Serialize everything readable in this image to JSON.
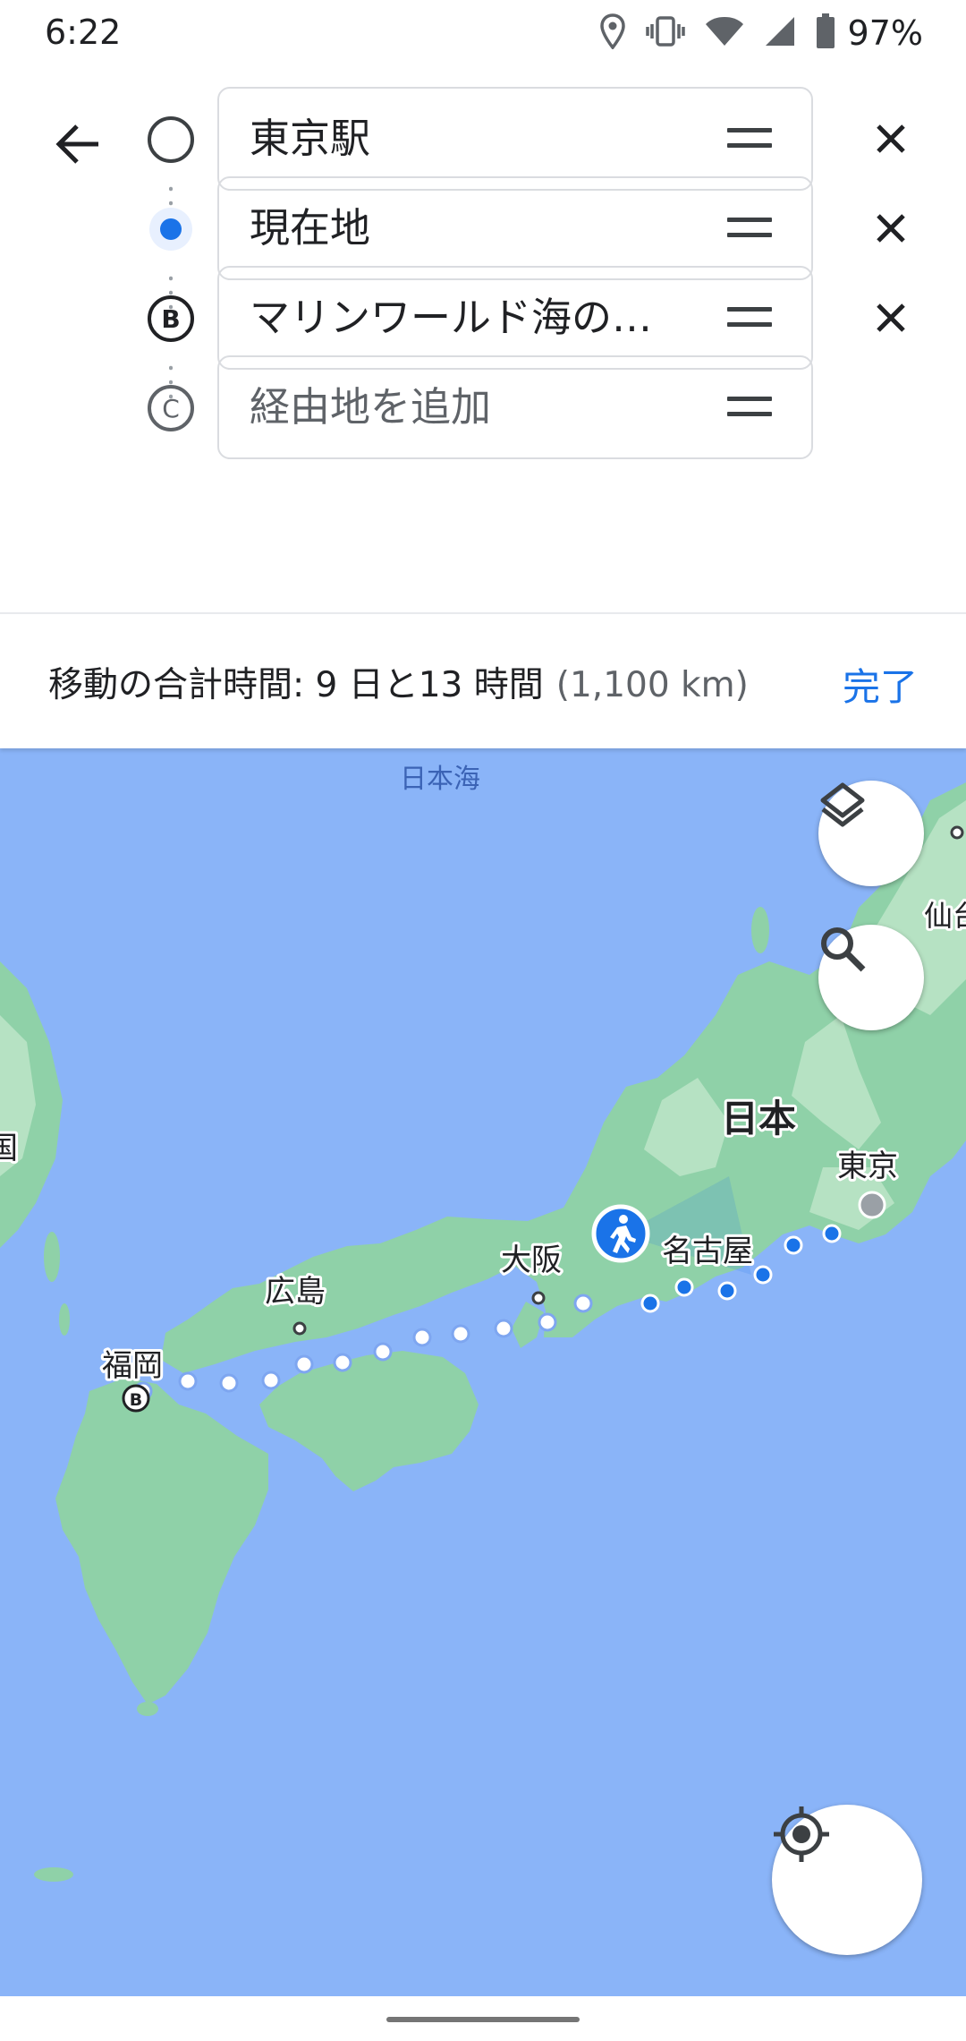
{
  "status_bar": {
    "time": "6:22",
    "battery": "97%",
    "icons": [
      "location-icon",
      "vibrate-icon",
      "wifi-icon",
      "signal-icon",
      "battery-icon"
    ]
  },
  "directions": {
    "back_icon": "arrow-back-icon",
    "stops": [
      {
        "marker": "origin-circle",
        "value": "東京駅",
        "placeholder": ""
      },
      {
        "marker": "current-location-dot",
        "value": "現在地",
        "placeholder": ""
      },
      {
        "marker": "B",
        "value": "マリンワールド海の…",
        "placeholder": ""
      },
      {
        "marker": "C",
        "value": "",
        "placeholder": "経由地を追加"
      }
    ]
  },
  "summary": {
    "label": "移動の合計時間: 9 日と13 時間",
    "distance": "(1,100 km)",
    "done": "完了"
  },
  "map": {
    "labels": {
      "sea": "日本海",
      "sendai": "仙台",
      "japan": "日本",
      "tokyo": "東京",
      "nagoya": "名古屋",
      "osaka": "大阪",
      "hiroshima": "広島",
      "fukuoka": "福岡",
      "korea": "国"
    },
    "destination_marker": "B",
    "colors": {
      "water": "#8ab4f8",
      "land": "#8fd1a8",
      "land_light": "#b6e2c3",
      "route": "#1a73e8"
    }
  }
}
